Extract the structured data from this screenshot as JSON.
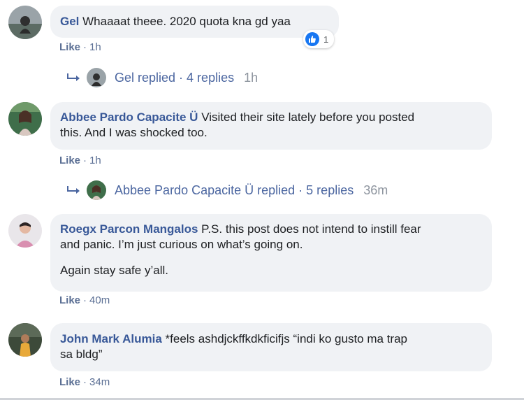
{
  "comments": [
    {
      "author": "Gel",
      "text_lines": [
        "Whaaaat theee. 2020 quota kna gd yaa"
      ],
      "like_label": "Like",
      "time": "1h",
      "reaction_count": "1",
      "reply": {
        "label": "Gel replied",
        "count": "4 replies",
        "time": "1h"
      }
    },
    {
      "author": "Abbee Pardo Capacite Ü",
      "text_lines": [
        "Visited their site lately before you posted",
        "this. And I was shocked too."
      ],
      "like_label": "Like",
      "time": "1h",
      "reply": {
        "label": "Abbee Pardo Capacite Ü replied",
        "count": "5 replies",
        "time": "36m"
      }
    },
    {
      "author": "Roegx Parcon Mangalos",
      "text_lines": [
        "P.S. this post does not intend to instill fear",
        "and panic. I’m just curious on what’s going on."
      ],
      "text_extra": "Again stay safe y’all.",
      "like_label": "Like",
      "time": "40m"
    },
    {
      "author": "John Mark Alumia",
      "text_lines": [
        "*feels ashdjckffkdkficifjs “indi ko gusto ma trap",
        "sa bldg”"
      ],
      "like_label": "Like",
      "time": "34m"
    }
  ],
  "separator": "·",
  "colors": {
    "author": "#385898",
    "bubble": "#f0f2f5",
    "meta": "#5b6f94",
    "like_blue": "#1877f2"
  }
}
